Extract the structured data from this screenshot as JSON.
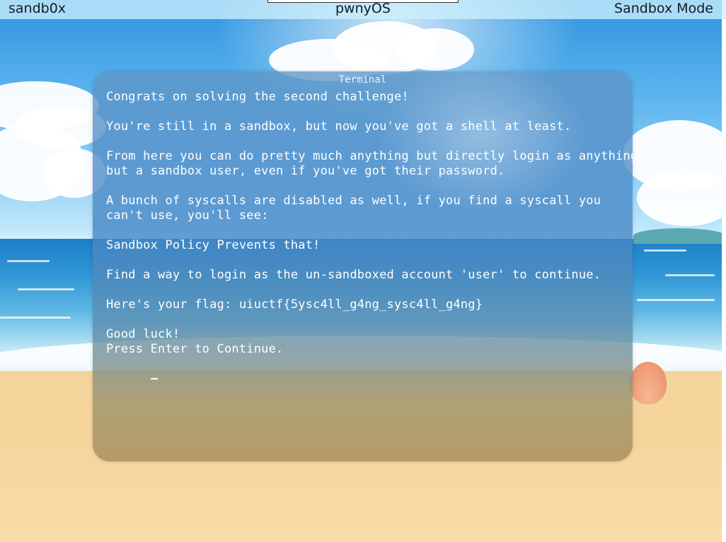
{
  "topbar": {
    "left_label": "sandb0x",
    "center_label": "pwnyOS",
    "right_label": "Sandbox Mode"
  },
  "terminal": {
    "title": "Terminal",
    "lines": [
      "Congrats on solving the second challenge!",
      "",
      "You're still in a sandbox, but now you've got a shell at least.",
      "",
      "From here you can do pretty much anything but directly login as anything",
      "but a sandbox user, even if you've got their password.",
      "",
      "A bunch of syscalls are disabled as well, if you find a syscall you",
      "can't use, you'll see:",
      "",
      "Sandbox Policy Prevents that!",
      "",
      "Find a way to login as the un-sandboxed account 'user' to continue.",
      "",
      "Here's your flag: uiuctf{5ysc4ll_g4ng_sysc4ll_g4ng}",
      "",
      "Good luck!",
      "Press Enter to Continue."
    ]
  },
  "icons": {
    "cursor": "text-cursor-icon"
  }
}
